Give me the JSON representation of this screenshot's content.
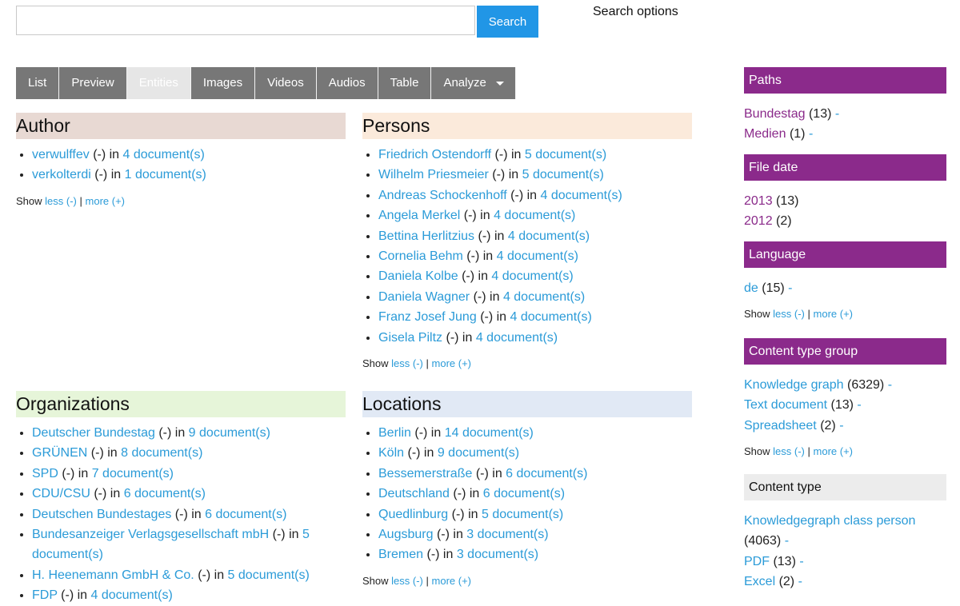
{
  "search": {
    "button": "Search",
    "options": "Search options",
    "value": ""
  },
  "tabs": [
    {
      "label": "List"
    },
    {
      "label": "Preview"
    },
    {
      "label": "Entities"
    },
    {
      "label": "Images"
    },
    {
      "label": "Videos"
    },
    {
      "label": "Audios"
    },
    {
      "label": "Table"
    },
    {
      "label": "Analyze"
    }
  ],
  "common": {
    "in": "in",
    "show": "Show",
    "less": "less (-)",
    "more_plain": "more (+)",
    "sep": "|",
    "minus": "(-)",
    "dash": "-"
  },
  "author": {
    "title": "Author",
    "items": [
      {
        "name": "verwulffev",
        "docs": "4 document(s)"
      },
      {
        "name": "verkolterdi",
        "docs": "1 document(s)"
      }
    ]
  },
  "persons": {
    "title": "Persons",
    "items": [
      {
        "name": "Friedrich Ostendorff",
        "docs": "5 document(s)"
      },
      {
        "name": "Wilhelm Priesmeier",
        "docs": "5 document(s)"
      },
      {
        "name": "Andreas Schockenhoff",
        "docs": "4 document(s)"
      },
      {
        "name": "Angela Merkel",
        "docs": "4 document(s)"
      },
      {
        "name": "Bettina Herlitzius",
        "docs": "4 document(s)"
      },
      {
        "name": "Cornelia Behm",
        "docs": "4 document(s)"
      },
      {
        "name": "Daniela Kolbe",
        "docs": "4 document(s)"
      },
      {
        "name": "Daniela Wagner",
        "docs": "4 document(s)"
      },
      {
        "name": "Franz Josef Jung",
        "docs": "4 document(s)"
      },
      {
        "name": "Gisela Piltz",
        "docs": "4 document(s)"
      }
    ]
  },
  "organizations": {
    "title": "Organizations",
    "items": [
      {
        "name": "Deutscher Bundestag",
        "docs": "9 document(s)"
      },
      {
        "name": "GRÜNEN",
        "docs": "8 document(s)"
      },
      {
        "name": "SPD",
        "docs": "7 document(s)"
      },
      {
        "name": "CDU/CSU",
        "docs": "6 document(s)"
      },
      {
        "name": "Deutschen Bundestages",
        "docs": "6 document(s)"
      },
      {
        "name": "Bundesanzeiger Verlagsgesellschaft mbH",
        "docs": "5 document(s)"
      },
      {
        "name": "H. Heenemann GmbH & Co.",
        "docs": "5 document(s)"
      },
      {
        "name": "FDP",
        "docs": "4 document(s)"
      }
    ]
  },
  "locations": {
    "title": "Locations",
    "items": [
      {
        "name": "Berlin",
        "docs": "14 document(s)"
      },
      {
        "name": "Köln",
        "docs": "9 document(s)"
      },
      {
        "name": "Bessemerstraße",
        "docs": "6 document(s)"
      },
      {
        "name": "Deutschland",
        "docs": "6 document(s)"
      },
      {
        "name": "Quedlinburg",
        "docs": "5 document(s)"
      },
      {
        "name": "Augsburg",
        "docs": "3 document(s)"
      },
      {
        "name": "Bremen",
        "docs": "3 document(s)"
      }
    ]
  },
  "sidebar": {
    "paths": {
      "title": "Paths",
      "items": [
        {
          "name": "Bundestag",
          "count": "(13)"
        },
        {
          "name": "Medien",
          "count": "(1)"
        }
      ]
    },
    "file_date": {
      "title": "File date",
      "items": [
        {
          "name": "2013",
          "count": "(13)"
        },
        {
          "name": "2012",
          "count": "(2)"
        }
      ]
    },
    "language": {
      "title": "Language",
      "items": [
        {
          "name": "de",
          "count": "(15)"
        }
      ]
    },
    "content_type_group": {
      "title": "Content type group",
      "items": [
        {
          "name": "Knowledge graph",
          "count": "(6329)"
        },
        {
          "name": "Text document",
          "count": "(13)"
        },
        {
          "name": "Spreadsheet",
          "count": "(2)"
        }
      ]
    },
    "content_type": {
      "title": "Content type",
      "items": [
        {
          "name": "Knowledgegraph class person",
          "count": "(4063)"
        },
        {
          "name": "PDF",
          "count": "(13)"
        },
        {
          "name": "Excel",
          "count": "(2)"
        }
      ]
    }
  },
  "colors": {
    "author_head": "#e8d9d3",
    "persons_head": "#fbeadb",
    "org_head": "#e6f5d9",
    "loc_head": "#e1e9f5",
    "sidebar_purple": "#8b2a8b",
    "link_blue": "#2b9bd8"
  }
}
